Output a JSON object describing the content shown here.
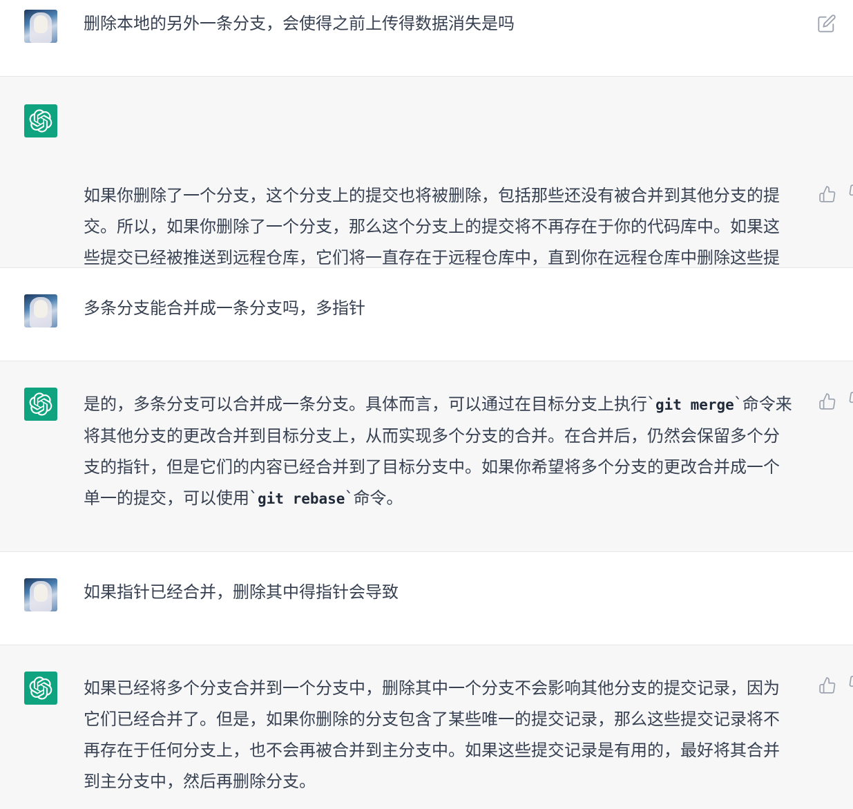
{
  "conversation": {
    "messages": [
      {
        "role": "user",
        "avatar": "user-avatar",
        "text": "删除本地的另外一条分支，会使得之前上传得数据消失是吗",
        "action_icon": "edit-icon"
      },
      {
        "role": "assistant",
        "avatar": "openai-logo-icon",
        "text": "如果你删除了一个分支，这个分支上的提交也将被删除，包括那些还没有被合并到其他分支的提交。所以，如果你删除了一个分支，那么这个分支上的提交将不再存在于你的代码库中。如果这些提交已经被推送到远程仓库，它们将一直存在于远程仓库中，直到你在远程仓库中删除这些提交。",
        "action_icons": [
          "thumbs-up-icon",
          "thumbs-down-icon"
        ]
      },
      {
        "role": "user",
        "avatar": "user-avatar",
        "text": "多条分支能合并成一条分支吗，多指针"
      },
      {
        "role": "assistant",
        "avatar": "openai-logo-icon",
        "parts": [
          "是的，多条分支可以合并成一条分支。具体而言，可以通过在目标分支上执行`",
          "git merge",
          "`命令来将其他分支的更改合并到目标分支上，从而实现多个分支的合并。在合并后，仍然会保留多个分支的指针，但是它们的内容已经合并到了目标分支中。如果你希望将多个分支的更改合并成一个单一的提交，可以使用`",
          "git rebase",
          "`命令。"
        ],
        "action_icons": [
          "thumbs-up-icon",
          "thumbs-down-icon"
        ]
      },
      {
        "role": "user",
        "avatar": "user-avatar",
        "text": "如果指针已经合并，删除其中得指针会导致"
      },
      {
        "role": "assistant",
        "avatar": "openai-logo-icon",
        "text": "如果已经将多个分支合并到一个分支中，删除其中一个分支不会影响其他分支的提交记录，因为它们已经合并了。但是，如果你删除的分支包含了某些唯一的提交记录，那么这些提交记录将不再存在于任何分支上，也不会再被合并到主分支中。如果这些提交记录是有用的，最好将其合并到主分支中，然后再删除分支。",
        "action_icons": [
          "thumbs-up-icon",
          "thumbs-down-icon"
        ]
      }
    ]
  },
  "colors": {
    "user_bg": "#ffffff",
    "assistant_bg": "#f7f7f8",
    "logo_green": "#10a37f",
    "text": "#374151",
    "border": "#e5e7eb",
    "icon": "#9ca3af"
  }
}
